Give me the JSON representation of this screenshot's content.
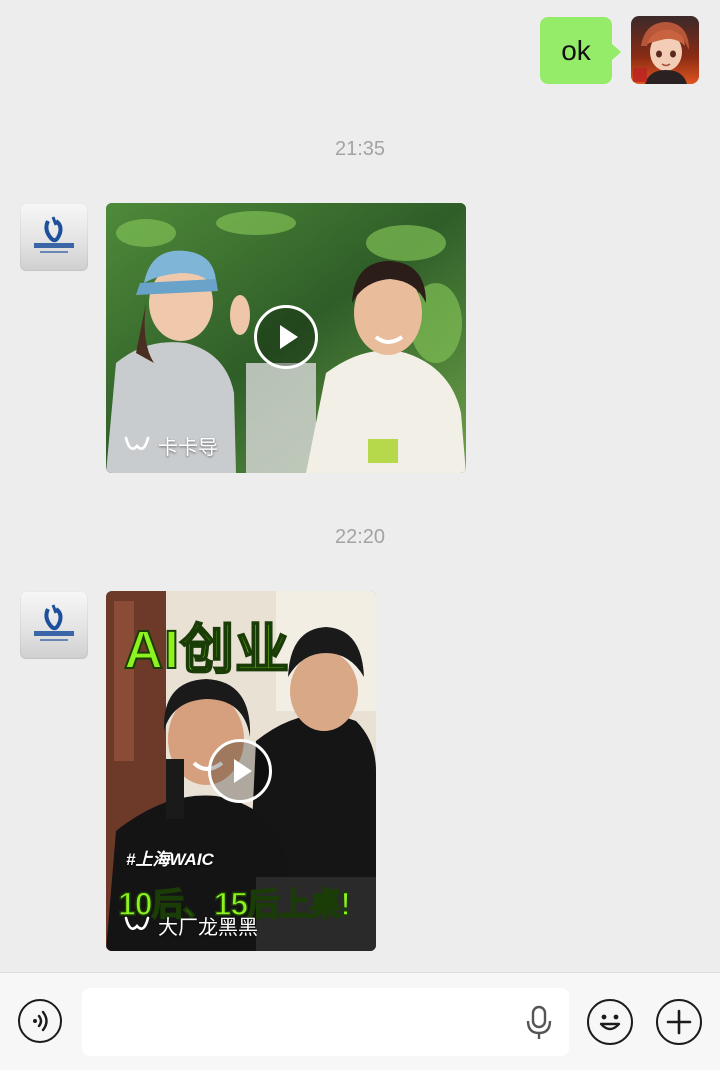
{
  "messages": {
    "outgoing_text": "ok",
    "timestamp_1": "21:35",
    "timestamp_2": "22:20",
    "video_1": {
      "channel_name": "卡卡导"
    },
    "video_2": {
      "title_text": "AI创业",
      "hashtag": "#上海WAIC",
      "subtitle_text": "10后、15后上桌!",
      "channel_name": "大厂龙黑黑"
    }
  },
  "input_bar": {
    "text_value": "",
    "placeholder": ""
  },
  "icons": {
    "voice_toggle": "voice-icon",
    "microphone": "microphone-icon",
    "emoji": "emoji-icon",
    "add": "plus-icon",
    "play": "play-icon",
    "channels": "channels-logo-icon"
  },
  "colors": {
    "background": "#ededed",
    "outgoing_bubble": "#95ec69",
    "timestamp_text": "#a3a3a3",
    "headline_green": "#8ef21f"
  }
}
